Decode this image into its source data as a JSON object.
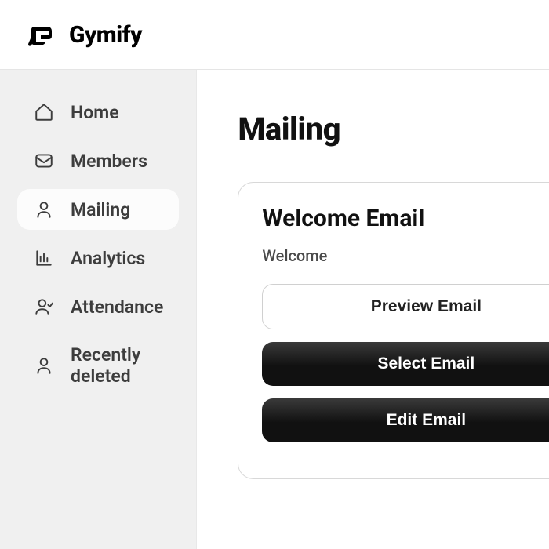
{
  "brand": {
    "name": "Gymify"
  },
  "sidebar": {
    "items": [
      {
        "label": "Home"
      },
      {
        "label": "Members"
      },
      {
        "label": "Mailing"
      },
      {
        "label": "Analytics"
      },
      {
        "label": "Attendance"
      },
      {
        "label": "Recently deleted"
      }
    ],
    "activeIndex": 2
  },
  "page": {
    "title": "Mailing"
  },
  "card": {
    "title": "Welcome Email",
    "subtitle": "Welcome",
    "buttons": {
      "preview": "Preview Email",
      "select": "Select Email",
      "edit": "Edit Email"
    }
  }
}
